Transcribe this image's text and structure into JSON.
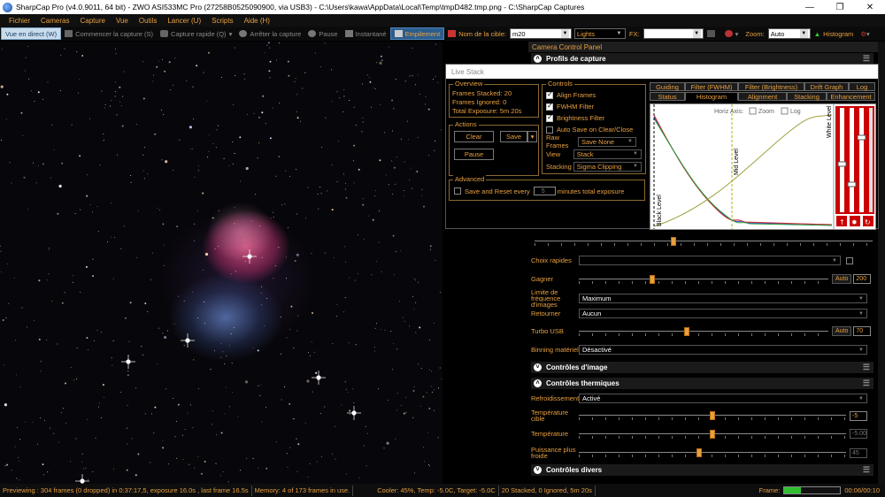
{
  "window": {
    "title": "SharpCap Pro (v4.0.9011, 64 bit) - ZWO ASI533MC Pro (27258B0525090900, via USB3) - C:\\Users\\kawa\\AppData\\Local\\Temp\\tmpD482.tmp.png - C:\\SharpCap Captures"
  },
  "menu": [
    "Fichier",
    "Cameras",
    "Capture",
    "Vue",
    "Outils",
    "Lancer (U)",
    "Scripts",
    "Aide (H)"
  ],
  "toolbar": {
    "live": "Vue en direct (W)",
    "start": "Commencer la capture (S)",
    "quick": "Capture rapide (Q)",
    "stop": "Arrêter la capture",
    "pause": "Pause",
    "snapshot": "Instantané",
    "stack": "Empilement",
    "target_label": "Nom de la cible:",
    "target_value": "m20",
    "frame_type": "Lights",
    "fx_label": "FX:",
    "fx_value": "",
    "zoom_label": "Zoom:",
    "zoom_value": "Auto",
    "histogram": "Histogram"
  },
  "panel": {
    "title": "Camera Control Panel",
    "capture_profiles": "Profils de capture",
    "quick_choice": "Choix rapides",
    "gain_label": "Gagner",
    "gain_value": "200",
    "gain_level": 0.29,
    "frame_rate_label": "Limite de fréquence d'images",
    "frame_rate_value": "Maximum",
    "flip_label": "Retourner",
    "flip_value": "Aucun",
    "turbo_label": "Turbo USB",
    "turbo_value": "70",
    "turbo_level": 0.43,
    "binning_label": "Binning matériel",
    "binning_value": "Désactivé",
    "auto": "Auto",
    "image_controls": "Contrôles d'image",
    "thermal_controls": "Contrôles thermiques",
    "cooling_label": "Refroidissement",
    "cooling_value": "Activé",
    "target_temp_label": "Température cible",
    "target_temp_value": "-5",
    "target_temp_level": 0.5,
    "temp_label": "Température",
    "temp_value": "-5.00",
    "temp_level": 0.5,
    "power_label": "Puissance plus froide",
    "power_value": "45",
    "power_level": 0.45,
    "misc_controls": "Contrôles divers"
  },
  "livestack": {
    "title": "Live Stack",
    "overview_title": "Overview",
    "frames_stacked": "Frames Stacked: 20",
    "frames_ignored": "Frames Ignored:  0",
    "total_exposure": "Total Exposure:   5m 20s",
    "actions_title": "Actions",
    "clear": "Clear",
    "save": "Save",
    "pause": "Pause",
    "advanced_title": "Advanced",
    "save_reset_label": "Save and Reset every",
    "save_reset_value": "5",
    "minutes_label": "minutes total exposure",
    "controls_title": "Controls",
    "align": "Align Frames",
    "fwhm": "FWHM Filter",
    "brightness": "Brightness Filter",
    "autosave": "Auto Save on Clear/Close",
    "raw_frames_label": "Raw Frames",
    "raw_frames_value": "Save None",
    "view_label": "View",
    "view_value": "Stack",
    "stacking_label": "Stacking",
    "stacking_value": "Sigma Clipping",
    "tabs_top": [
      "Guiding",
      "Filter (FWHM)",
      "Filter (Brightness)",
      "Drift Graph",
      "Log"
    ],
    "tabs_bottom": [
      "Status",
      "Histogram",
      "Alignment",
      "Stacking",
      "Enhancement"
    ],
    "horiz_axis": "Horiz Axis:",
    "zoom": "Zoom",
    "log": "Log",
    "black_level": "Black Level",
    "mid_level": "Mid Level",
    "white_level": "White Level"
  },
  "status": {
    "preview": "Previewing : 304 frames (0 dropped) in 0:37:17,5, exposure 16.0s , last frame 16.5s",
    "memory": "Memory: 4 of 173 frames in use.",
    "cooler": "Cooler: 45%, Temp: -5.0C, Target: -5.0C",
    "stacked": "20 Stacked, 0 Ignored, 5m 20s",
    "frame_label": "Frame:",
    "frame_progress": 0.3,
    "frame_time": "00:06/00:10"
  }
}
